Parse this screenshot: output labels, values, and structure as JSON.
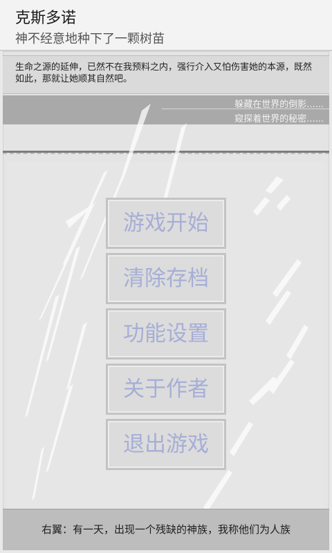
{
  "header": {
    "title": "克斯多诺",
    "subtitle": "神不经意地种下了一颗树苗"
  },
  "intro": {
    "text": "生命之源的延伸，已然不在我预料之内，强行介入又怕伤害她的本源，既然如此，那就让她顺其自然吧。"
  },
  "strip": {
    "line1": "躲藏在世界的倒影......",
    "line2": "窥探着世界的秘密......"
  },
  "menu": {
    "items": [
      {
        "label": "游戏开始"
      },
      {
        "label": "清除存档"
      },
      {
        "label": "功能设置"
      },
      {
        "label": "关于作者"
      },
      {
        "label": "退出游戏"
      }
    ]
  },
  "footer": {
    "text": "右翼：有一天，出现一个残缺的神族，我称他们为人族"
  }
}
